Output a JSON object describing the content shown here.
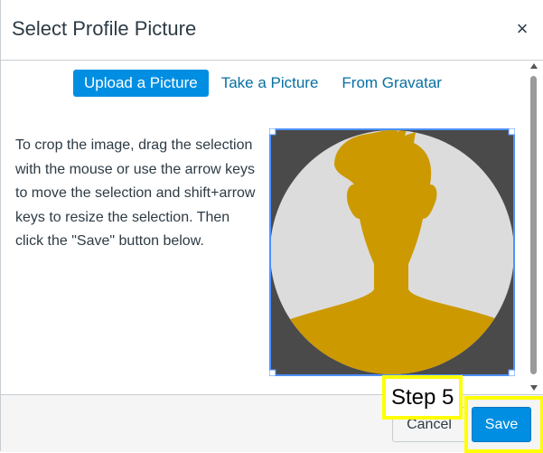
{
  "dialog": {
    "title": "Select Profile Picture",
    "close_glyph": "×"
  },
  "tabs": [
    {
      "label": "Upload a Picture",
      "active": true
    },
    {
      "label": "Take a Picture",
      "active": false
    },
    {
      "label": "From Gravatar",
      "active": false
    }
  ],
  "instructions": "To crop the image, drag the selection with the mouse or use the arrow keys to move the selection and shift+arrow keys to resize the selection. Then click the \"Save\" button below.",
  "crop": {
    "icon": "avatar-placeholder",
    "colors": {
      "background": "#4a4a4a",
      "circle": "#dcdcdc",
      "silhouette": "#cc9900",
      "selection": "#4d90fe"
    }
  },
  "footer": {
    "cancel_label": "Cancel",
    "save_label": "Save"
  },
  "annotation": {
    "step_label": "Step 5",
    "color": "#ffff00"
  },
  "colors": {
    "accent": "#008ee2",
    "link": "#0770a3"
  }
}
